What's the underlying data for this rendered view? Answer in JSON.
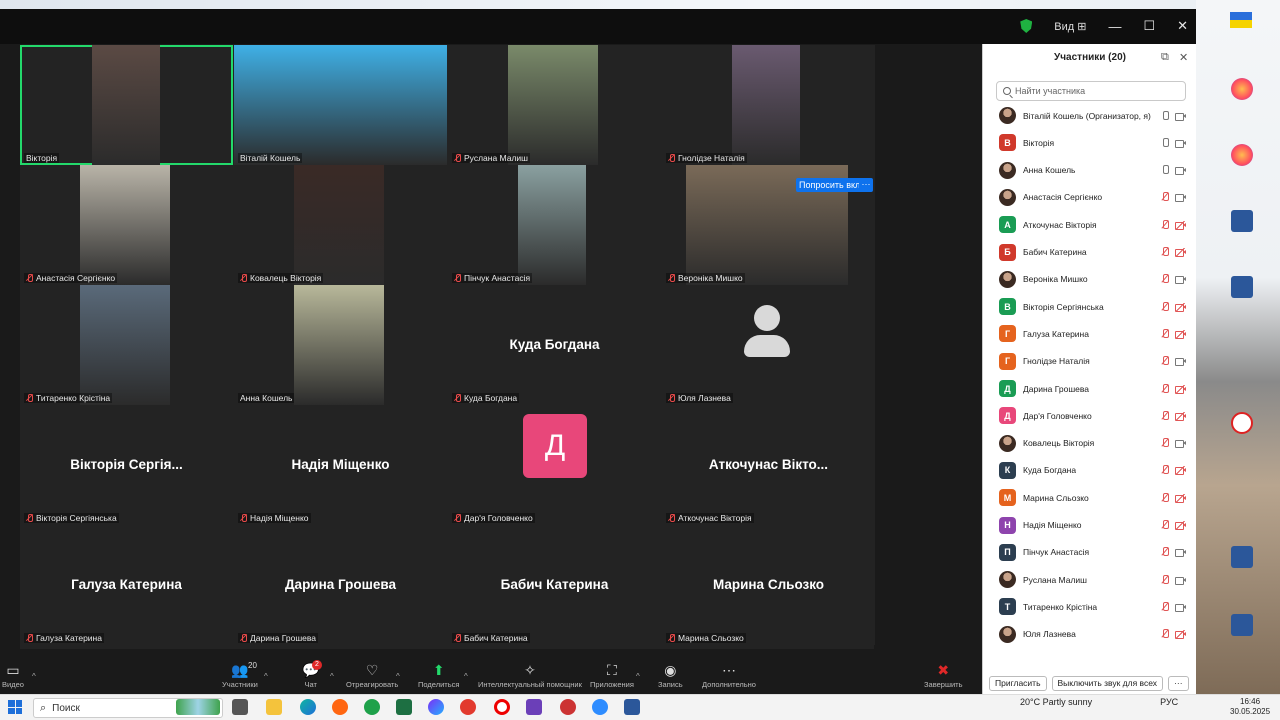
{
  "window": {
    "view_label": "Вид"
  },
  "grid": {
    "tiles": [
      {
        "name": "Вікторія",
        "big": "",
        "muted": false,
        "active": true
      },
      {
        "name": "Віталій Кошель",
        "big": "",
        "muted": false
      },
      {
        "name": "Руслана Малиш",
        "big": "",
        "muted": true
      },
      {
        "name": "Гнолідзе Наталія",
        "big": "",
        "muted": true
      },
      {
        "name": "Анастасія Сергієнко",
        "big": "",
        "muted": true
      },
      {
        "name": "Ковалець Вікторія",
        "big": "",
        "muted": true
      },
      {
        "name": "Пінчук Анастасія",
        "big": "",
        "muted": true
      },
      {
        "name": "Вероніка Мишко",
        "big": "",
        "muted": true
      },
      {
        "name": "Титаренко Крістіна",
        "big": "",
        "muted": true
      },
      {
        "name": "Анна Кошель",
        "big": "",
        "muted": false
      },
      {
        "name": "Куда Богдана",
        "big": "Куда Богдана",
        "muted": true
      },
      {
        "name": "Юля Лазнева",
        "big": "",
        "muted": true
      },
      {
        "name": "Вікторія Сергіянська",
        "big": "Вікторія Сергія...",
        "muted": true
      },
      {
        "name": "Надія Міщенко",
        "big": "Надія Міщенко",
        "muted": true
      },
      {
        "name": "Дар'я Головченко",
        "big": "",
        "muted": true,
        "avatar_letter": "Д"
      },
      {
        "name": "Аткочунас Вікторія",
        "big": "Аткочунас  Вікто...",
        "muted": true
      },
      {
        "name": "Галуза Катерина",
        "big": "Галуза Катерина",
        "muted": true
      },
      {
        "name": "Дарина Грошева",
        "big": "Дарина Грошева",
        "muted": true
      },
      {
        "name": "Бабич Катерина",
        "big": "Бабич Катерина",
        "muted": true
      },
      {
        "name": "Марина Сльозко",
        "big": "Марина Сльозко",
        "muted": true
      }
    ],
    "ask_unmute_label": "Попросить вкл",
    "more_label": "···"
  },
  "toolbar": {
    "participants_count": "20",
    "chat_badge": "2",
    "items": [
      "Видео",
      "Участники",
      "Чат",
      "Отреагировать",
      "Поделиться",
      "Интеллектуальный помощник",
      "Приложения",
      "Запись",
      "Дополнительно",
      "Завершить"
    ]
  },
  "panel": {
    "title": "Участники (20)",
    "search_placeholder": "Найти участника",
    "participants": [
      {
        "name": "Віталій Кошель (Организатор, я)",
        "letter": "",
        "color": "",
        "photo": true,
        "mic": "on",
        "cam": "on"
      },
      {
        "name": "Вікторія",
        "letter": "В",
        "color": "#d0392b",
        "photo": false,
        "mic": "on",
        "cam": "on"
      },
      {
        "name": "Анна Кошель",
        "letter": "",
        "color": "",
        "photo": true,
        "mic": "on",
        "cam": "on"
      },
      {
        "name": "Анастасія Сергієнко",
        "letter": "",
        "color": "",
        "photo": true,
        "mic": "off",
        "cam": "on"
      },
      {
        "name": "Аткочунас Вікторія",
        "letter": "А",
        "color": "#1a9c54",
        "photo": false,
        "mic": "off",
        "cam": "off"
      },
      {
        "name": "Бабич Катерина",
        "letter": "Б",
        "color": "#d0392b",
        "photo": false,
        "mic": "off",
        "cam": "off"
      },
      {
        "name": "Вероніка Мишко",
        "letter": "",
        "color": "",
        "photo": true,
        "mic": "off",
        "cam": "on"
      },
      {
        "name": "Вікторія Сергіянська",
        "letter": "В",
        "color": "#1a9c54",
        "photo": false,
        "mic": "off",
        "cam": "off"
      },
      {
        "name": "Галуза Катерина",
        "letter": "Г",
        "color": "#e5631e",
        "photo": false,
        "mic": "off",
        "cam": "off"
      },
      {
        "name": "Гнолідзе Наталія",
        "letter": "Г",
        "color": "#e5631e",
        "photo": false,
        "mic": "off",
        "cam": "on"
      },
      {
        "name": "Дарина Грошева",
        "letter": "Д",
        "color": "#1a9c54",
        "photo": false,
        "mic": "off",
        "cam": "off"
      },
      {
        "name": "Дар'я Головченко",
        "letter": "Д",
        "color": "#e8477a",
        "photo": false,
        "mic": "off",
        "cam": "off"
      },
      {
        "name": "Ковалець Вікторія",
        "letter": "",
        "color": "",
        "photo": true,
        "mic": "off",
        "cam": "on"
      },
      {
        "name": "Куда Богдана",
        "letter": "К",
        "color": "#2c3e50",
        "photo": false,
        "mic": "off",
        "cam": "off"
      },
      {
        "name": "Марина Сльозко",
        "letter": "М",
        "color": "#e5631e",
        "photo": false,
        "mic": "off",
        "cam": "off"
      },
      {
        "name": "Надія Міщенко",
        "letter": "Н",
        "color": "#8e44ad",
        "photo": false,
        "mic": "off",
        "cam": "off"
      },
      {
        "name": "Пінчук Анастасія",
        "letter": "П",
        "color": "#2c3e50",
        "photo": false,
        "mic": "off",
        "cam": "on"
      },
      {
        "name": "Руслана Малиш",
        "letter": "",
        "color": "",
        "photo": true,
        "mic": "off",
        "cam": "on"
      },
      {
        "name": "Титаренко Крістіна",
        "letter": "Т",
        "color": "#2c3e50",
        "photo": false,
        "mic": "off",
        "cam": "on"
      },
      {
        "name": "Юля Лазнева",
        "letter": "",
        "color": "",
        "photo": true,
        "mic": "off",
        "cam": "off"
      }
    ],
    "invite_label": "Пригласить",
    "mute_all_label": "Выключить звук для всех",
    "more_label": "···"
  },
  "taskbar": {
    "search_label": "Поиск",
    "weather": "20°C  Partly sunny",
    "lang": "РУС",
    "time": "16:46",
    "date": "30.05.2025"
  }
}
